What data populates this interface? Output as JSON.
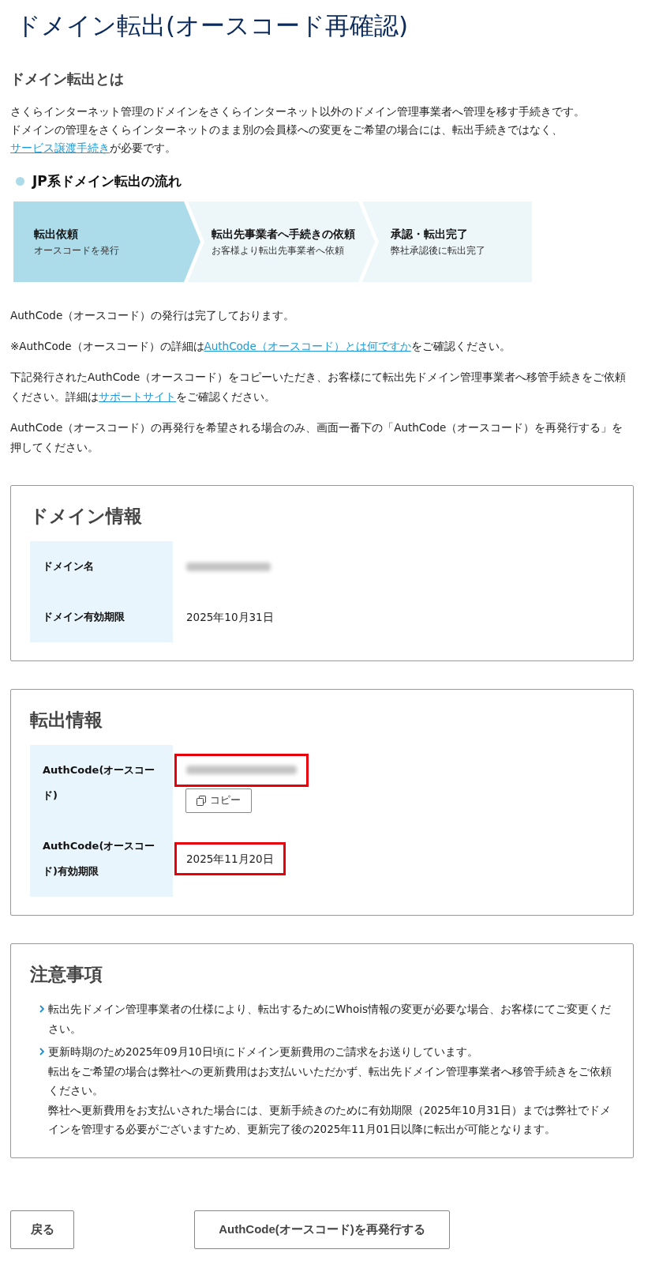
{
  "page_title": "ドメイン転出(オースコード再確認)",
  "intro": {
    "heading": "ドメイン転出とは",
    "paragraphs": [
      [
        {
          "text": "さくらインターネット管理のドメインをさくらインターネット以外のドメイン管理事業者へ管理を移す手続きです。"
        }
      ],
      [
        {
          "text": "ドメインの管理をさくらインターネットのまま別の会員様への変更をご希望の場合には、転出手続きではなく、"
        },
        {
          "text": "サービス譲渡手続き",
          "link": true
        },
        {
          "text": "が必要です。"
        }
      ]
    ]
  },
  "flow": {
    "heading": "JP系ドメイン転出の流れ",
    "steps": [
      {
        "title": "転出依頼",
        "subtitle": "オースコードを発行",
        "current": true
      },
      {
        "title": "転出先事業者へ手続きの依頼",
        "subtitle": "お客様より転出先事業者へ依頼",
        "current": false
      },
      {
        "title": "承認・転出完了",
        "subtitle": "弊社承認後に転出完了",
        "current": false
      }
    ]
  },
  "messages": [
    [
      {
        "text": "AuthCode（オースコード）の発行は完了しております。"
      }
    ],
    [
      {
        "text": "※AuthCode（オースコード）の詳細は"
      },
      {
        "text": "AuthCode（オースコード）とは何ですか",
        "link": true
      },
      {
        "text": "をご確認ください。"
      }
    ],
    [
      {
        "text": "下記発行されたAuthCode（オースコード）をコピーいただき、お客様にて転出先ドメイン管理事業者へ移管手続きをご依頼ください。詳細は"
      },
      {
        "text": "サポートサイト",
        "link": true
      },
      {
        "text": "をご確認ください。"
      }
    ],
    [
      {
        "text": "AuthCode（オースコード）の再発行を希望される場合のみ、画面一番下の「AuthCode（オースコード）を再発行する」を押してください。"
      }
    ]
  ],
  "domain_info": {
    "title": "ドメイン情報",
    "rows": [
      {
        "label": "ドメイン名",
        "redacted": true,
        "highlighted": false
      },
      {
        "label": "ドメイン有効期限",
        "value": "2025年10月31日",
        "redacted": false,
        "highlighted": false
      }
    ]
  },
  "transfer_info": {
    "title": "転出情報",
    "rows": [
      {
        "label": "AuthCode(オースコード)",
        "redacted": true,
        "highlighted": true,
        "copy_button": "コピー"
      },
      {
        "label": "AuthCode(オースコード)有効期限",
        "value": "2025年11月20日",
        "redacted": false,
        "highlighted": true
      }
    ]
  },
  "notices": {
    "title": "注意事項",
    "items": [
      {
        "lines": [
          "転出先ドメイン管理事業者の仕様により、転出するためにWhois情報の変更が必要な場合、お客様にてご変更ください。"
        ]
      },
      {
        "lines": [
          "更新時期のため2025年09月10日頃にドメイン更新費用のご請求をお送りしています。",
          "転出をご希望の場合は弊社への更新費用はお支払いいただかず、転出先ドメイン管理事業者へ移管手続きをご依頼ください。",
          "弊社へ更新費用をお支払いされた場合には、更新手続きのために有効期限（2025年10月31日）までは弊社でドメインを管理する必要がございますため、更新完了後の2025年11月01日以降に転出が可能となります。"
        ]
      }
    ]
  },
  "buttons": [
    {
      "label": "戻る",
      "kind": "back"
    },
    {
      "label": "AuthCode(オースコード)を再発行する",
      "kind": "reissue"
    }
  ]
}
